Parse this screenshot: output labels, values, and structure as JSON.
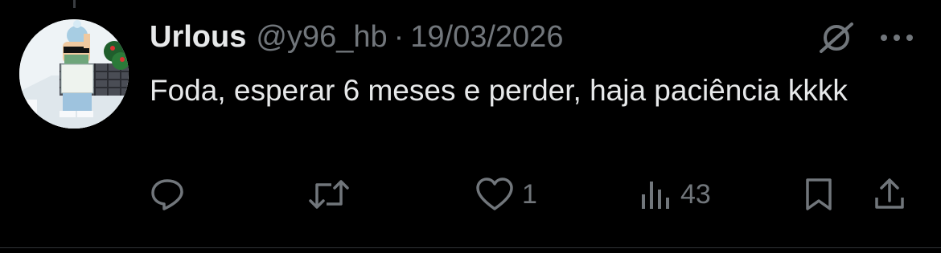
{
  "tweet": {
    "display_name": "Urlous",
    "handle": "@y96_hb",
    "separator": "·",
    "date": "19/03/2026",
    "text": "Foda, esperar 6 meses e perder, haja paciência kkkk"
  },
  "actions": {
    "reply_count": "",
    "retweet_count": "",
    "like_count": "1",
    "views_count": "43"
  },
  "icons": {
    "reply": "reply-icon",
    "retweet": "retweet-icon",
    "like": "heart-icon",
    "views": "views-icon",
    "bookmark": "bookmark-icon",
    "share": "share-icon",
    "grok": "grok-icon",
    "more": "more-icon"
  },
  "colors": {
    "background": "#000000",
    "primary_text": "#e7e9ea",
    "secondary_text": "#71767b"
  }
}
